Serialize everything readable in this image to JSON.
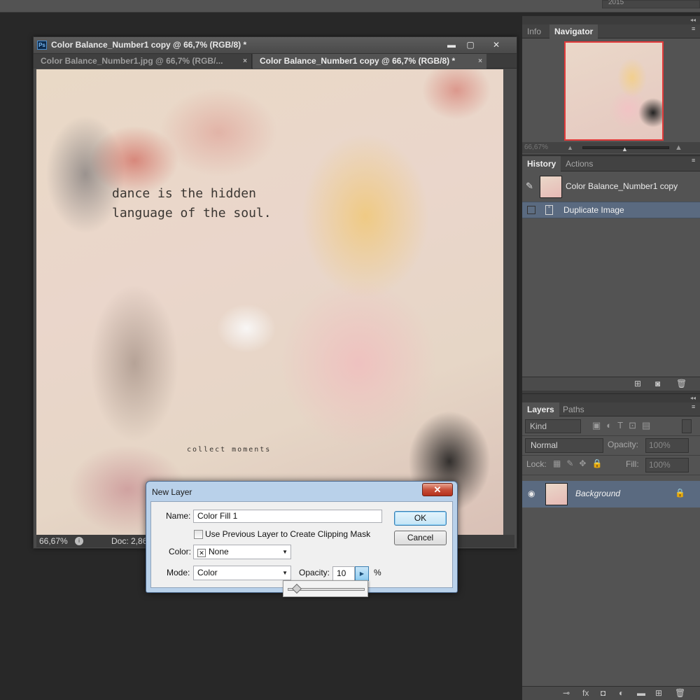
{
  "app": {
    "workspace_label": "2015"
  },
  "document": {
    "title": "Color Balance_Number1 copy @ 66,7% (RGB/8) *",
    "ps_badge": "Ps",
    "window_buttons": {
      "minimize": "▬",
      "maximize": "▢",
      "close": "✕"
    },
    "tabs": [
      {
        "label": "Color Balance_Number1.jpg @ 66,7% (RGB/...",
        "close": "×"
      },
      {
        "label": "Color Balance_Number1 copy @ 66,7% (RGB/8) *",
        "close": "×"
      }
    ],
    "canvas": {
      "quote_line1": "dance is the hidden",
      "quote_line2": "language of the soul.",
      "collect_text": "collect moments"
    },
    "status": {
      "zoom": "66,67%",
      "doc": "Doc: 2,86M"
    }
  },
  "panels": {
    "navigator": {
      "tabs": [
        "Info",
        "Navigator"
      ],
      "zoom": "66,67%"
    },
    "history": {
      "tabs": [
        "History",
        "Actions"
      ],
      "snapshot_label": "Color Balance_Number1 copy",
      "items": [
        {
          "label": "Duplicate Image"
        }
      ]
    },
    "layers": {
      "tabs": [
        "Layers",
        "Paths"
      ],
      "filter_kind": "Kind",
      "blend_mode": "Normal",
      "opacity_label": "Opacity:",
      "opacity_value": "100%",
      "lock_label": "Lock:",
      "fill_label": "Fill:",
      "fill_value": "100%",
      "items": [
        {
          "name": "Background"
        }
      ]
    }
  },
  "dialog": {
    "title": "New Layer",
    "close": "✕",
    "name_label": "Name:",
    "name_value": "Color Fill 1",
    "clip_label": "Use Previous Layer to Create Clipping Mask",
    "color_label": "Color:",
    "color_value": "None",
    "mode_label": "Mode:",
    "mode_value": "Color",
    "opacity_label": "Opacity:",
    "opacity_value": "10",
    "percent": "%",
    "ok_label": "OK",
    "cancel_label": "Cancel"
  }
}
